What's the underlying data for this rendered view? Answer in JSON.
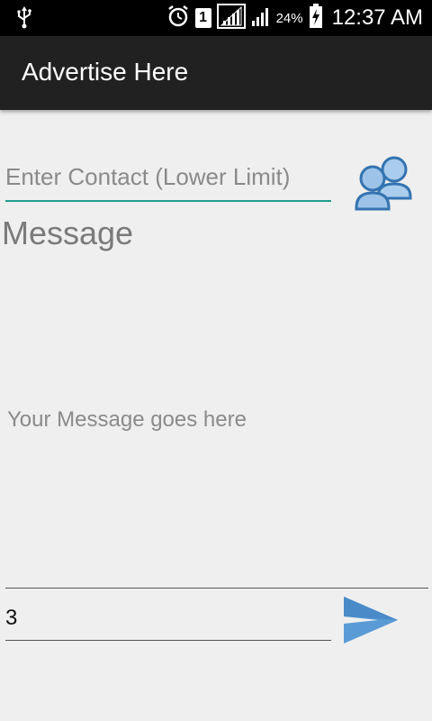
{
  "status_bar": {
    "icons": [
      "usb-icon",
      "alarm-icon",
      "sim-1-icon",
      "signal-icon",
      "signal-icon",
      "battery-charging-icon"
    ],
    "sim_label": "1",
    "battery_percent": "24%",
    "time": "12:37 AM"
  },
  "app_bar": {
    "title": "Advertise Here"
  },
  "form": {
    "contact_placeholder": "Enter Contact (Lower Limit)",
    "contact_value": "",
    "contacts_icon": "contacts-group-icon",
    "message_label": "Message",
    "message_placeholder": "Your Message goes here",
    "message_value": "",
    "count_value": "3",
    "send_icon": "send-icon"
  },
  "colors": {
    "status_bar": "#000000",
    "app_bar": "#212121",
    "background": "#efefef",
    "accent_underline": "#1e9e8e",
    "icon_blue": "#5b9bd5"
  }
}
